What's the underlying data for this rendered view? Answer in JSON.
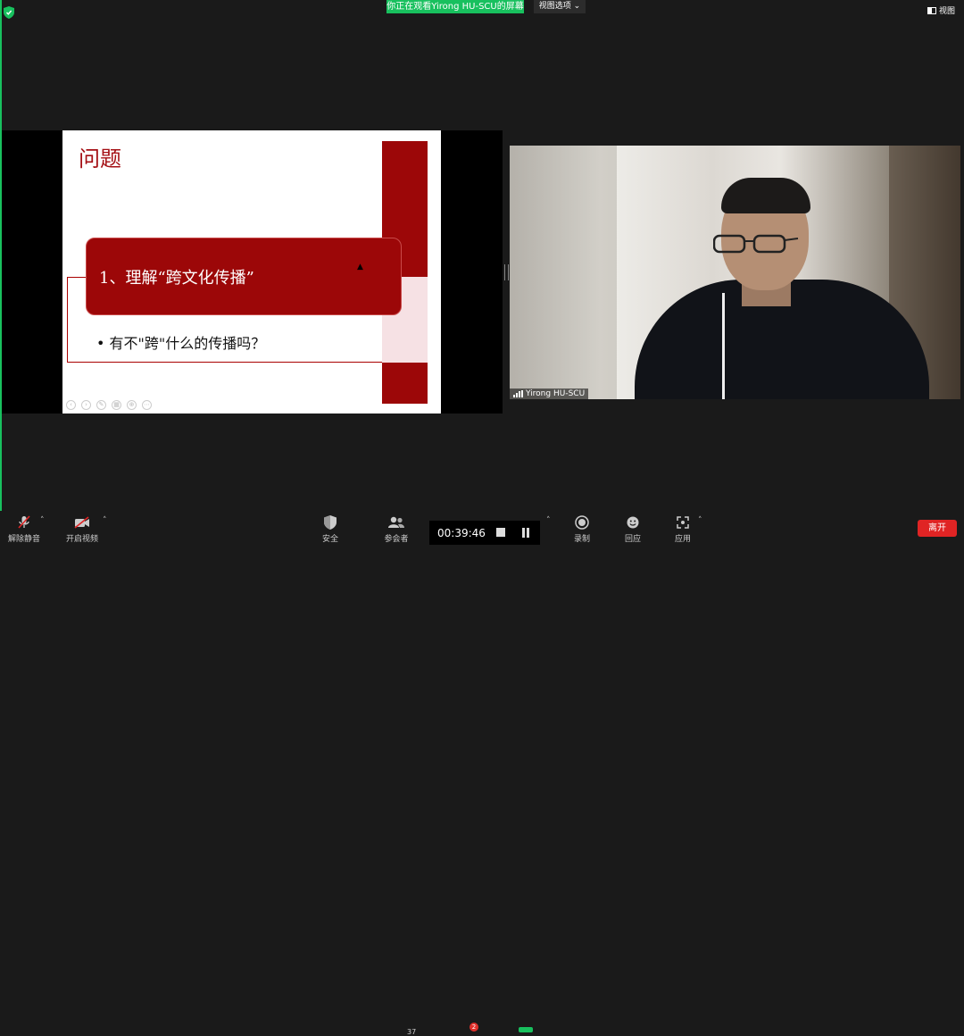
{
  "top_bar": {
    "share_banner": "你正在观看Yirong  HU-SCU的屏幕",
    "view_options": "视图选项 ⌄",
    "view_button": "视图"
  },
  "slide": {
    "title": "问题",
    "box_text": "1、理解“跨文化传播”",
    "bullet": "• 有不\"跨\"什么的传播吗？",
    "accent_color": "#9c0708"
  },
  "video": {
    "participant_name": "Yirong HU-SCU"
  },
  "toolbar": {
    "unmute_label": "解除静音",
    "start_video_label": "开启视频",
    "security_label": "安全",
    "participants_label": "参会者",
    "participants_count": "37",
    "chat_badge": "2",
    "timer": "00:39:46",
    "record_label": "录制",
    "reactions_label": "回应",
    "apps_label": "应用",
    "leave_label": "离开"
  }
}
